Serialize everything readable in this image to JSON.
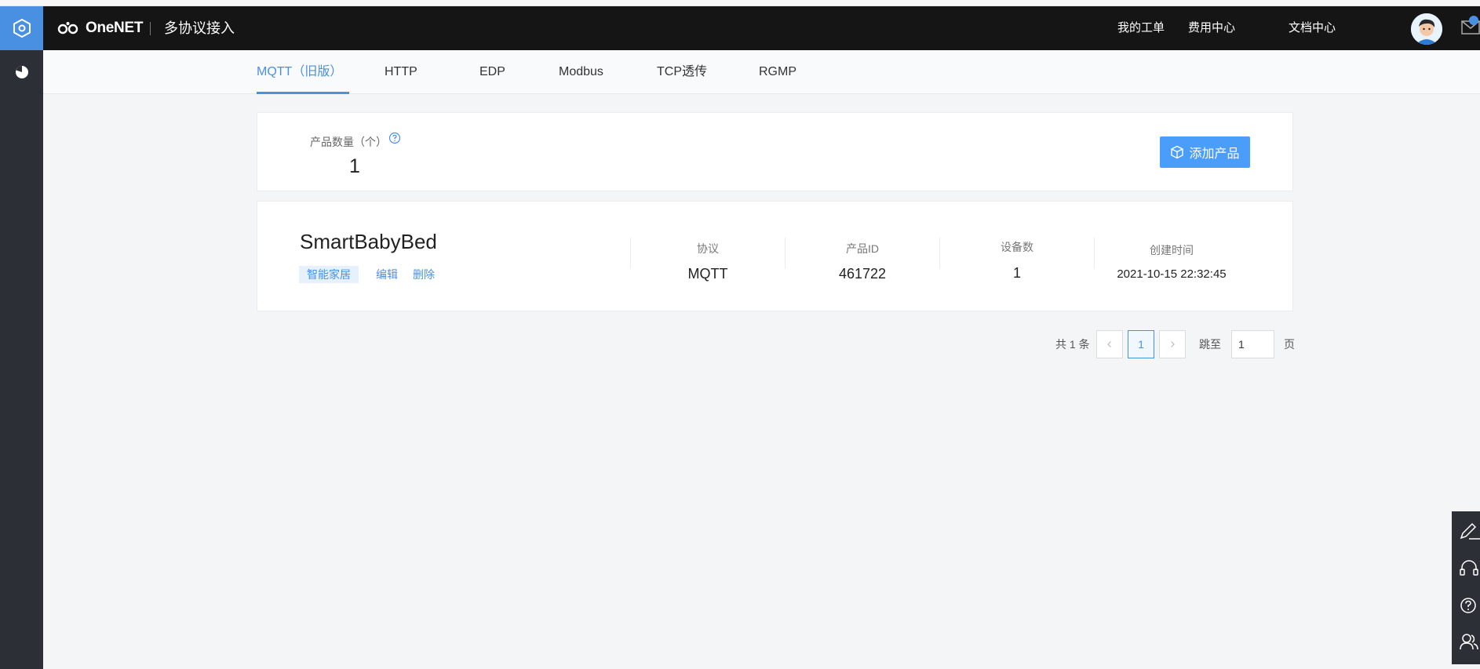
{
  "header": {
    "logo_text": "OneNET",
    "app_title": "多协议接入",
    "links": [
      "我的工单",
      "费用中心",
      "文档中心"
    ]
  },
  "tabs": [
    "MQTT（旧版）",
    "HTTP",
    "EDP",
    "Modbus",
    "TCP透传",
    "RGMP"
  ],
  "active_tab": "MQTT（旧版）",
  "summary": {
    "count_label": "产品数量（个）",
    "count_value": "1",
    "add_button": "添加产品"
  },
  "product": {
    "name": "SmartBabyBed",
    "tag": "智能家居",
    "edit": "编辑",
    "delete": "删除",
    "columns": [
      {
        "label": "协议",
        "value": "MQTT"
      },
      {
        "label": "产品ID",
        "value": "461722"
      },
      {
        "label": "设备数",
        "value": "1"
      },
      {
        "label": "创建时间",
        "value": "2021-10-15 22:32:45"
      }
    ]
  },
  "pagination": {
    "total": "共 1 条",
    "current": "1",
    "jump_label": "跳至",
    "jump_value": "1",
    "page_suffix": "页"
  },
  "colors": {
    "accent": "#4a90e2",
    "header_bg": "#151515",
    "sidebar_bg": "#2c2f36"
  },
  "icons": {
    "menu_button": "hexagon-icon",
    "sidebar": [
      "pie-chart-icon"
    ],
    "floating": [
      "edit-icon",
      "headset-icon",
      "help-icon",
      "users-icon"
    ]
  }
}
